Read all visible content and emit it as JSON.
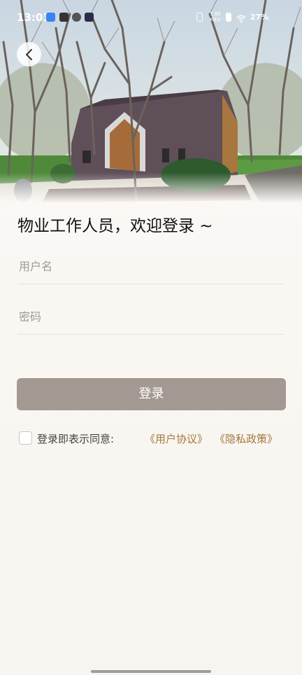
{
  "status_bar": {
    "time": "13:01",
    "net_speed_value": "7.90",
    "net_speed_unit": "KB/s",
    "battery": "27%"
  },
  "page": {
    "title": "物业工作人员，欢迎登录 ~"
  },
  "form": {
    "username_placeholder": "用户名",
    "username_value": "",
    "password_placeholder": "密码",
    "password_value": "",
    "login_label": "登录"
  },
  "agreement": {
    "prefix": "登录即表示同意:",
    "user_agreement": "《用户协议》",
    "privacy_policy": "《隐私政策》",
    "checked": false
  },
  "colors": {
    "login_button": "#a49892",
    "link": "#a3773c"
  },
  "icons": {
    "back": "chevron-left-icon",
    "checkbox": "checkbox-icon"
  }
}
